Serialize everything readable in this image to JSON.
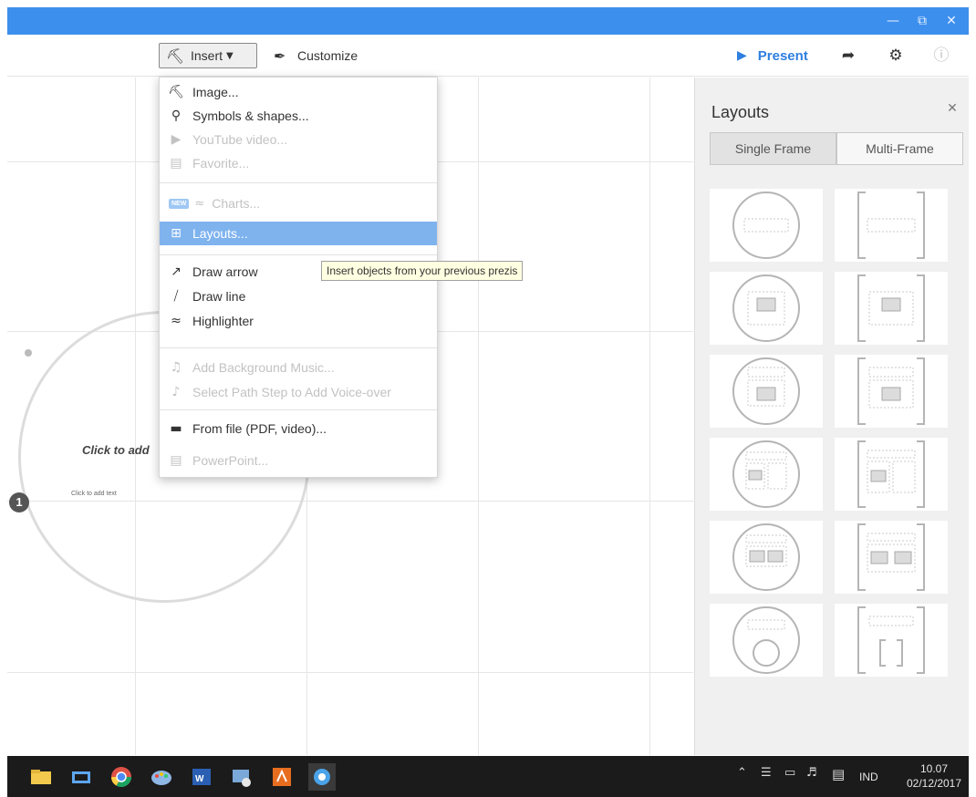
{
  "window": {
    "minimize_icon": "minimize-icon",
    "restore_icon": "restore-icon",
    "close_icon": "close-icon"
  },
  "toolbar": {
    "insert_label": "Insert",
    "customize_label": "Customize",
    "present_label": "Present",
    "share_icon": "share-icon",
    "settings_icon": "gear-icon",
    "help_icon": "help-icon"
  },
  "insert_menu": {
    "items": [
      {
        "label": "Image...",
        "icon": "image-icon",
        "enabled": true
      },
      {
        "label": "Symbols & shapes...",
        "icon": "lightbulb-icon",
        "enabled": true
      },
      {
        "label": "YouTube video...",
        "icon": "youtube-icon",
        "enabled": false
      },
      {
        "label": "Favorite...",
        "icon": "favorite-icon",
        "enabled": false
      },
      {
        "badge": "NEW",
        "label": "Charts...",
        "icon": "chart-icon",
        "enabled": false
      },
      {
        "label": "Layouts...",
        "icon": "layouts-icon",
        "enabled": true,
        "selected": true
      },
      {
        "label": "Draw arrow",
        "icon": "arrow-icon",
        "enabled": true
      },
      {
        "label": "Draw line",
        "icon": "line-icon",
        "enabled": true
      },
      {
        "label": "Highlighter",
        "icon": "highlighter-icon",
        "enabled": true
      },
      {
        "label": "Add Background Music...",
        "icon": "music-icon",
        "enabled": false
      },
      {
        "label": "Select Path Step to Add Voice-over",
        "icon": "note-icon",
        "enabled": false
      },
      {
        "label": "From file (PDF, video)...",
        "icon": "folder-icon",
        "enabled": true
      },
      {
        "label": "PowerPoint...",
        "icon": "powerpoint-icon",
        "enabled": false
      }
    ]
  },
  "tooltip": "Insert objects from your previous prezis",
  "canvas": {
    "title_placeholder": "Click to add",
    "text_placeholder": "Click to add text",
    "step_number": "1"
  },
  "panel": {
    "title": "Layouts",
    "tabs": [
      "Single Frame",
      "Multi-Frame"
    ],
    "active_tab": "Single Frame"
  },
  "taskbar": {
    "apps": [
      "file-explorer-icon",
      "task-view-icon",
      "chrome-icon",
      "paint-icon",
      "word-icon",
      "snipping-icon",
      "office-icon",
      "prezi-icon"
    ],
    "language": "IND",
    "time": "10.07",
    "date": "02/12/2017"
  }
}
